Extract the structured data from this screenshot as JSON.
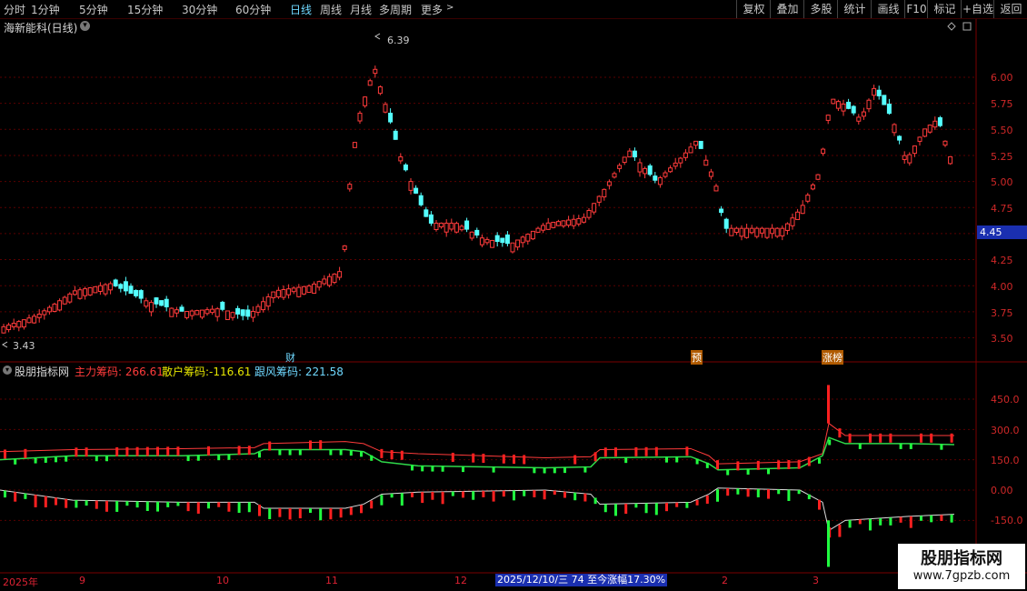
{
  "toolbar": {
    "periods": [
      "分时",
      "1分钟",
      "5分钟",
      "15分钟",
      "30分钟",
      "60分钟",
      "日线",
      "周线",
      "月线",
      "多周期",
      "更多"
    ],
    "active_period": "日线",
    "right_buttons": [
      "复权",
      "叠加",
      "多股",
      "统计",
      "画线",
      "F10",
      "标记",
      "+自选",
      "返回"
    ]
  },
  "main_panel": {
    "title": "海新能科(日线)",
    "high_marker": "6.39",
    "low_marker": "3.43",
    "y_ticks": [
      "6.00",
      "5.75",
      "5.50",
      "5.25",
      "5.00",
      "4.75",
      "4.25",
      "4.00",
      "3.75",
      "3.50"
    ],
    "current_price": "4.45",
    "event_tags": [
      "财",
      "预",
      "涨榜"
    ]
  },
  "indicator_panel": {
    "name": "股朋指标网",
    "items": [
      {
        "label": "主力筹码:",
        "value": "266.61",
        "color": "#ff3b3b"
      },
      {
        "label": "散户筹码:",
        "value": "-116.61",
        "color": "#e6e600"
      },
      {
        "label": "跟风筹码:",
        "value": "221.58",
        "color": "#6fd8ff"
      }
    ],
    "y_ticks": [
      "450.0",
      "300.0",
      "150.0",
      "0.00",
      "-150.0"
    ]
  },
  "x_axis": {
    "labels": [
      "2025年",
      "9",
      "10",
      "11",
      "12",
      "2",
      "3"
    ],
    "info_box": "2025/12/10/三 74 至今涨幅17.30%"
  },
  "watermark": {
    "title": "股朋指标网",
    "url": "www.7gpzb.com"
  },
  "colors": {
    "up": "#ff3b3b",
    "down": "#54ffff",
    "grid": "#5a0000",
    "accent": "#6fd8ff"
  },
  "chart_data": {
    "type": "candlestick",
    "title": "海新能科(日线)",
    "ylim": [
      3.35,
      6.55
    ],
    "highest": 6.39,
    "lowest": 3.43,
    "last": 5.25
  }
}
